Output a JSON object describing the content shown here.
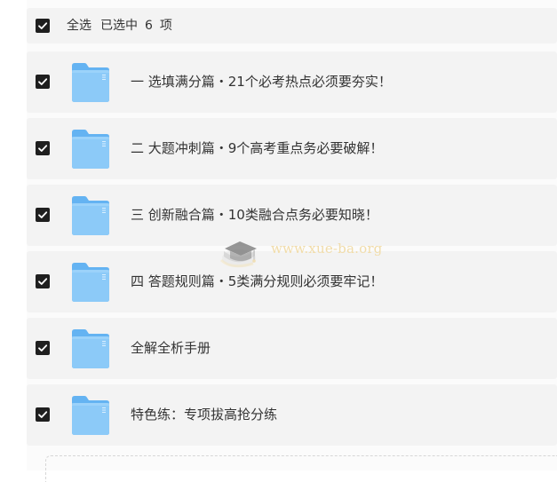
{
  "header": {
    "select_all_label": "全选",
    "selected_prefix": "已选中",
    "selected_count": "6",
    "selected_suffix": "项",
    "checked": true
  },
  "files": [
    {
      "name": "一  选填满分篇・21个必考热点必须要夯实！",
      "checked": true,
      "icon": "folder-icon"
    },
    {
      "name": "二  大题冲刺篇・9个高考重点务必要破解！",
      "checked": true,
      "icon": "folder-icon"
    },
    {
      "name": "三  创新融合篇・10类融合点务必要知晓！",
      "checked": true,
      "icon": "folder-icon"
    },
    {
      "name": "四  答题规则篇・5类满分规则必须要牢记！",
      "checked": true,
      "icon": "folder-icon"
    },
    {
      "name": "全解全析手册",
      "checked": true,
      "icon": "folder-icon"
    },
    {
      "name": "特色练：专项拔高抢分练",
      "checked": true,
      "icon": "folder-icon"
    }
  ],
  "watermark": {
    "text": "www.xue-ba.org",
    "icon": "graduation-cap-icon"
  },
  "colors": {
    "checkbox": "#1f1f1f",
    "folder_front": "#8ccaf8",
    "folder_back": "#64b3f2",
    "row_background": "#f3f3f3"
  }
}
